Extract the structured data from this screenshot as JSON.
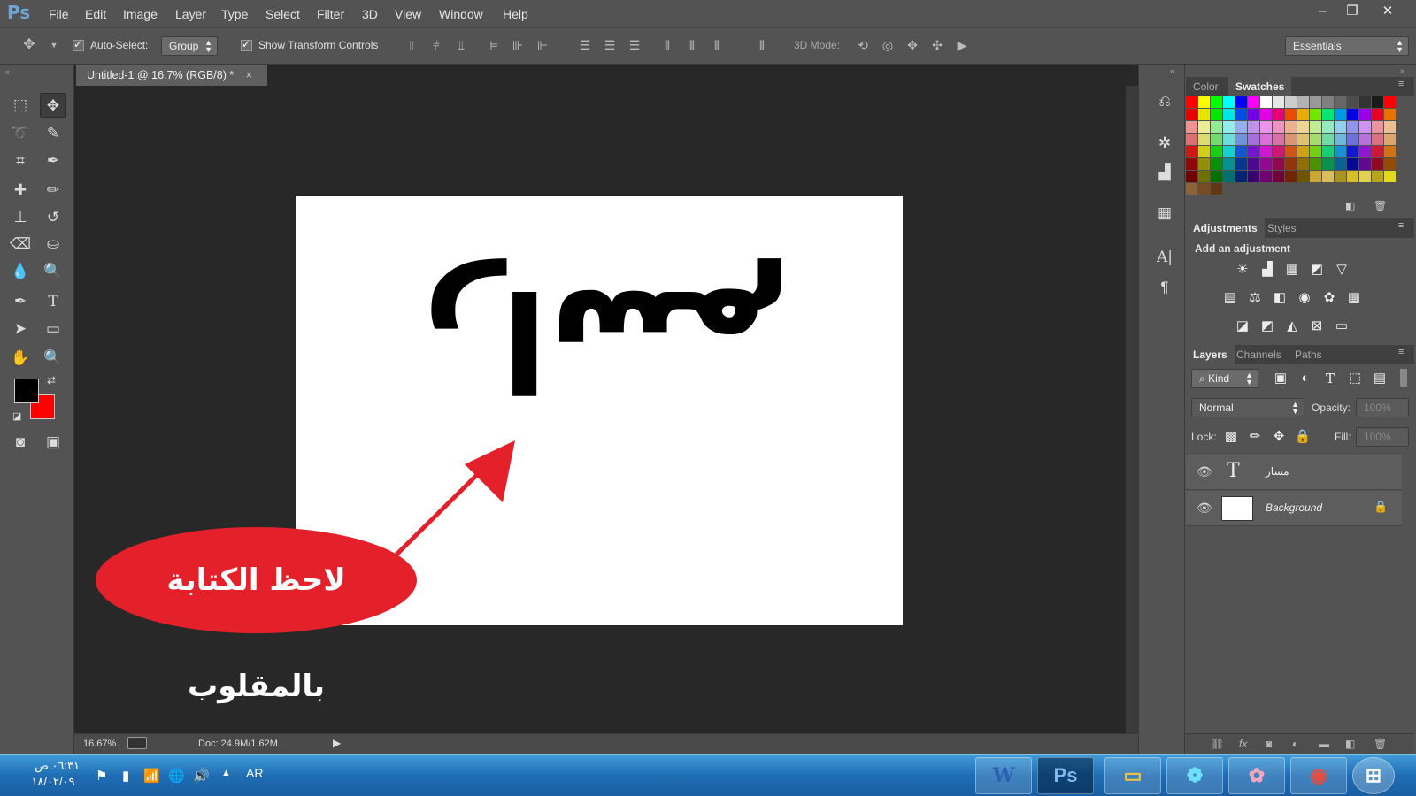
{
  "app": {
    "logo": "Ps"
  },
  "menu": [
    "File",
    "Edit",
    "Image",
    "Layer",
    "Type",
    "Select",
    "Filter",
    "3D",
    "View",
    "Window",
    "Help"
  ],
  "window_controls": {
    "minimize": "–",
    "restore": "❐",
    "close": "✕"
  },
  "options_bar": {
    "auto_select_label": "Auto-Select:",
    "auto_select_value": "Group",
    "show_transform_label": "Show Transform Controls",
    "mode_3d_label": "3D Mode:",
    "workspace": "Essentials"
  },
  "document": {
    "tab_title": "Untitled-1 @ 16.7% (RGB/8) *",
    "tab_close": "×",
    "canvas_text": "راسم",
    "annotation_text": "لاحظ الكتابة بالمقلوب"
  },
  "status_bar": {
    "zoom": "16.67%",
    "doc_info": "Doc: 24.9M/1.62M"
  },
  "color_panel": {
    "tabs": [
      "Color",
      "Swatches"
    ],
    "active": "Swatches"
  },
  "adjustments_panel": {
    "tabs": [
      "Adjustments",
      "Styles"
    ],
    "heading": "Add an adjustment"
  },
  "layers_panel": {
    "tabs": [
      "Layers",
      "Channels",
      "Paths"
    ],
    "kind_filter": "Kind",
    "blend_mode": "Normal",
    "opacity_label": "Opacity:",
    "opacity_value": "100%",
    "lock_label": "Lock:",
    "fill_label": "Fill:",
    "fill_value": "100%",
    "layers": [
      {
        "name": "مسار",
        "type": "text"
      },
      {
        "name": "Background",
        "type": "background"
      }
    ]
  },
  "taskbar": {
    "time": "٠٦:٣١ ص",
    "date": "١٨/٠٢/٠٩",
    "language": "AR",
    "apps": [
      "W",
      "Ps"
    ]
  },
  "colors": {
    "foreground": "#000000",
    "background": "#ff0000",
    "annotation": "#e4202a"
  }
}
